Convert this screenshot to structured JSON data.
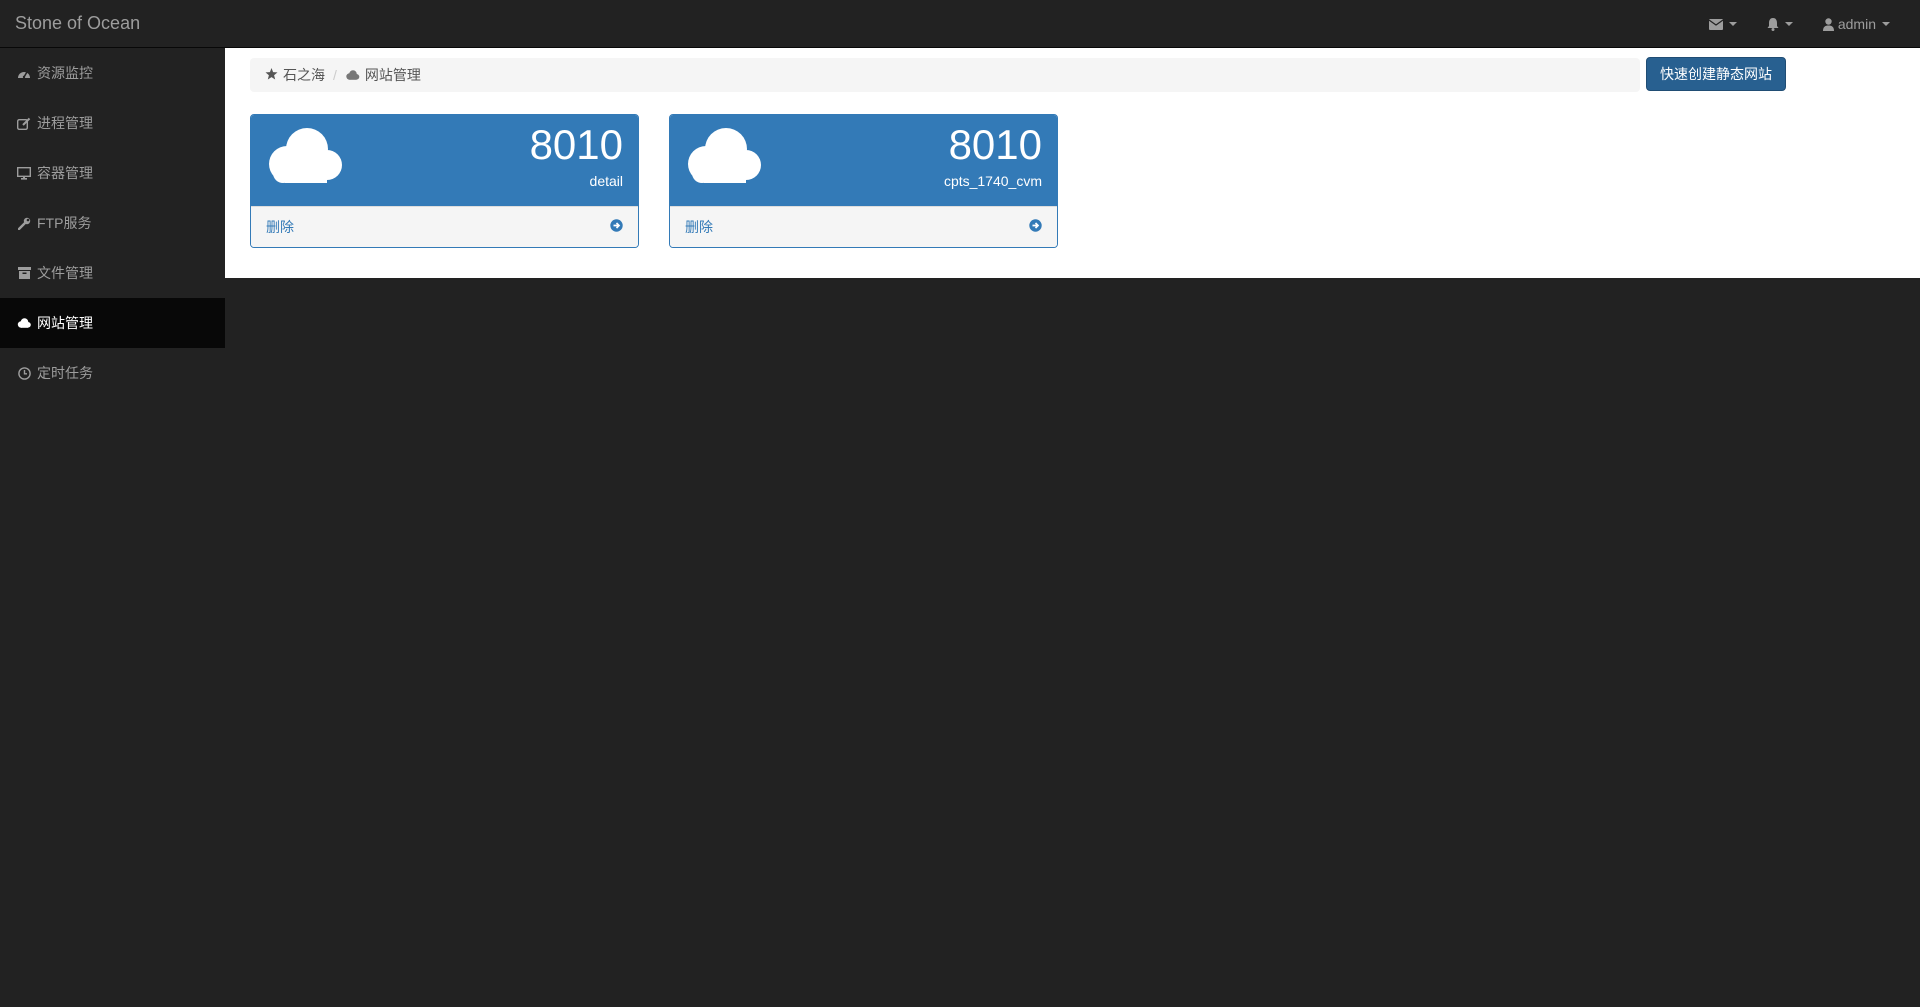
{
  "app": {
    "brand": "Stone of Ocean"
  },
  "navbar": {
    "items": [
      {
        "icon": "envelope-icon",
        "label": ""
      },
      {
        "icon": "bell-icon",
        "label": ""
      },
      {
        "icon": "user-icon",
        "label": "admin"
      }
    ]
  },
  "sidebar": {
    "items": [
      {
        "icon": "dashboard-icon",
        "label": "资源监控",
        "active": false
      },
      {
        "icon": "edit-icon",
        "label": "进程管理",
        "active": false
      },
      {
        "icon": "desktop-icon",
        "label": "容器管理",
        "active": false
      },
      {
        "icon": "wrench-icon",
        "label": "FTP服务",
        "active": false
      },
      {
        "icon": "archive-icon",
        "label": "文件管理",
        "active": false
      },
      {
        "icon": "cloud-icon",
        "label": "网站管理",
        "active": true
      },
      {
        "icon": "clock-icon",
        "label": "定时任务",
        "active": false
      }
    ]
  },
  "breadcrumb": {
    "items": [
      {
        "icon": "star-icon",
        "label": "石之海"
      },
      {
        "icon": "cloud-icon",
        "label": "网站管理"
      }
    ],
    "separator": "/"
  },
  "actions": {
    "quick_create_label": "快速创建静态网站"
  },
  "sites": [
    {
      "port": "8010",
      "name": "detail",
      "delete_label": "删除"
    },
    {
      "port": "8010",
      "name": "cpts_1740_cvm",
      "delete_label": "删除"
    }
  ],
  "colors": {
    "primary": "#337ab7",
    "button": "#286090",
    "navbar_bg": "#222222",
    "sidebar_active_bg": "#080808",
    "nav_text": "#9d9d9d"
  }
}
